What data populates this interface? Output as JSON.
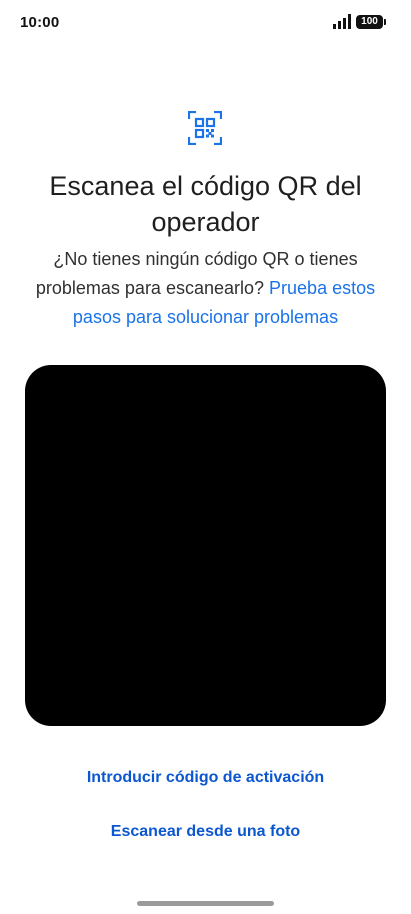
{
  "status_bar": {
    "time": "10:00",
    "battery_level": "100",
    "icons": [
      "signal-icon",
      "battery-icon"
    ]
  },
  "header": {
    "icon": "qr-code-icon",
    "title": "Escanea el código QR del operador",
    "description": "¿No tienes ningún código QR o tienes problemas para escanearlo?",
    "help_link": "Prueba estos pasos para solucionar problemas"
  },
  "camera": {
    "icon": "camera-preview"
  },
  "actions": {
    "enter_code": "Introducir código de activación",
    "scan_photo": "Escanear desde una foto"
  },
  "colors": {
    "accent": "#1a73e8",
    "action_text": "#0b57d0",
    "preview_background": "#000000"
  }
}
